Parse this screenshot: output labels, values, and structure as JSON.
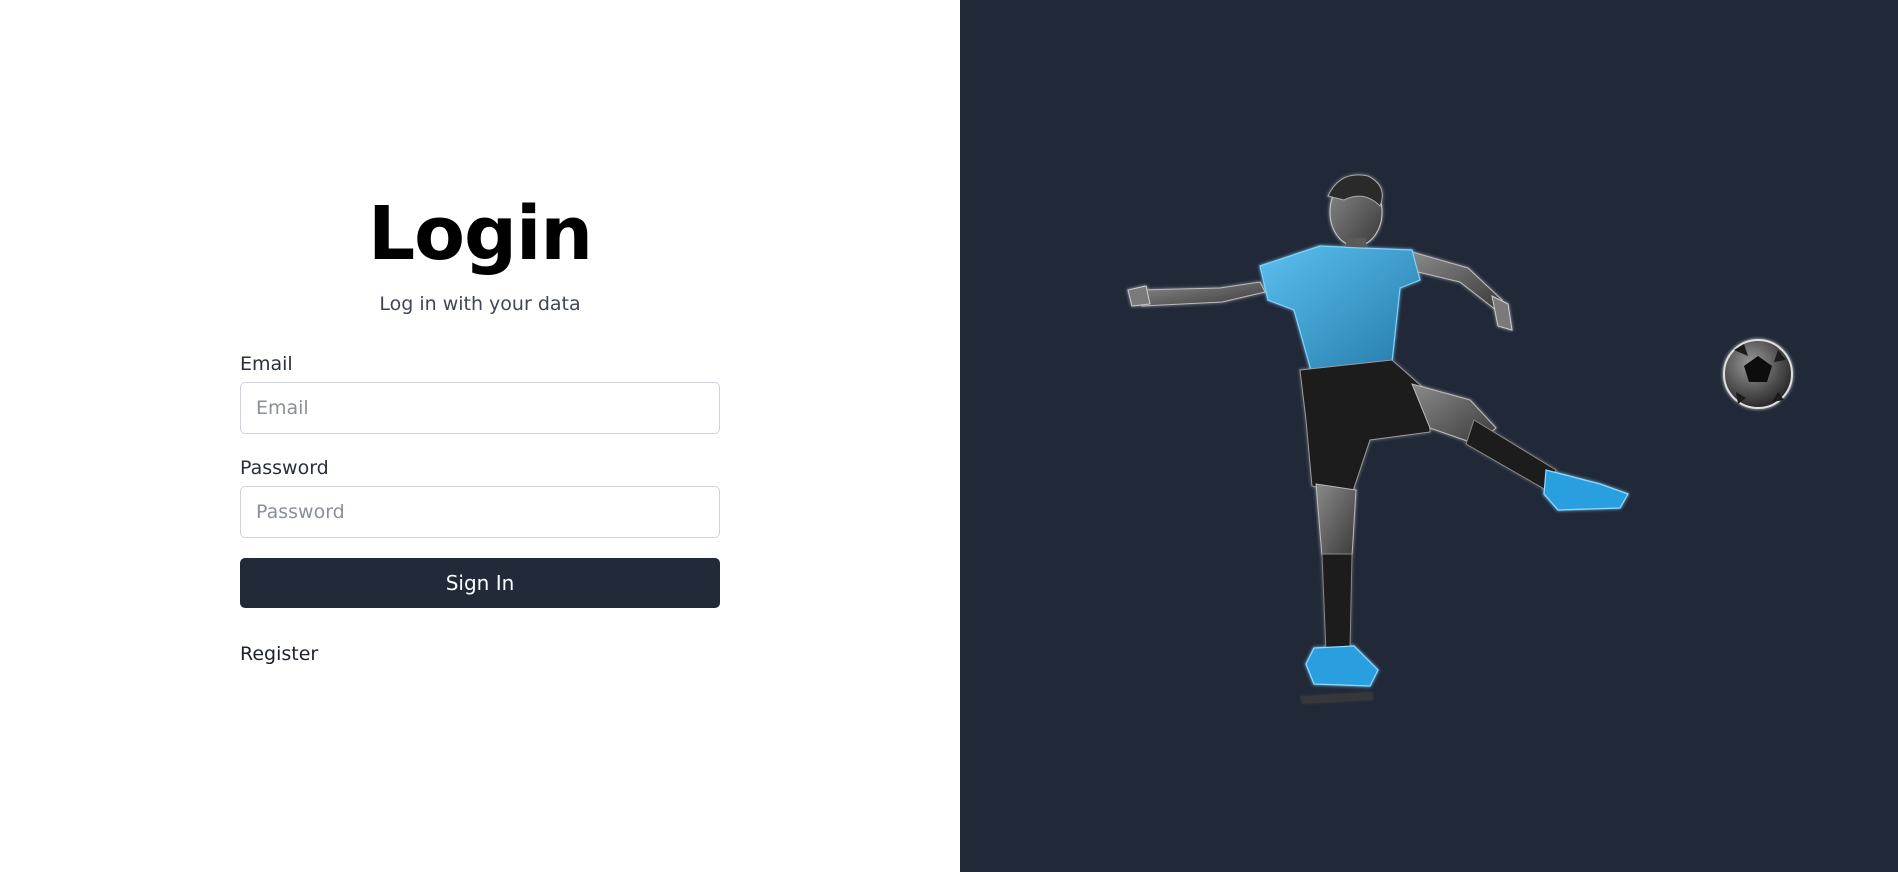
{
  "login": {
    "title": "Login",
    "subtitle": "Log in with your data",
    "email_label": "Email",
    "email_placeholder": "Email",
    "email_value": "",
    "password_label": "Password",
    "password_placeholder": "Password",
    "password_value": "",
    "sign_in_label": "Sign In",
    "register_label": "Register"
  },
  "hero": {
    "image": "soccer-player-kicking-ball-image",
    "background_color": "#212939",
    "accent_color": "#39a3dd"
  },
  "colors": {
    "button_bg": "#222a39",
    "button_text": "#ffffff"
  }
}
